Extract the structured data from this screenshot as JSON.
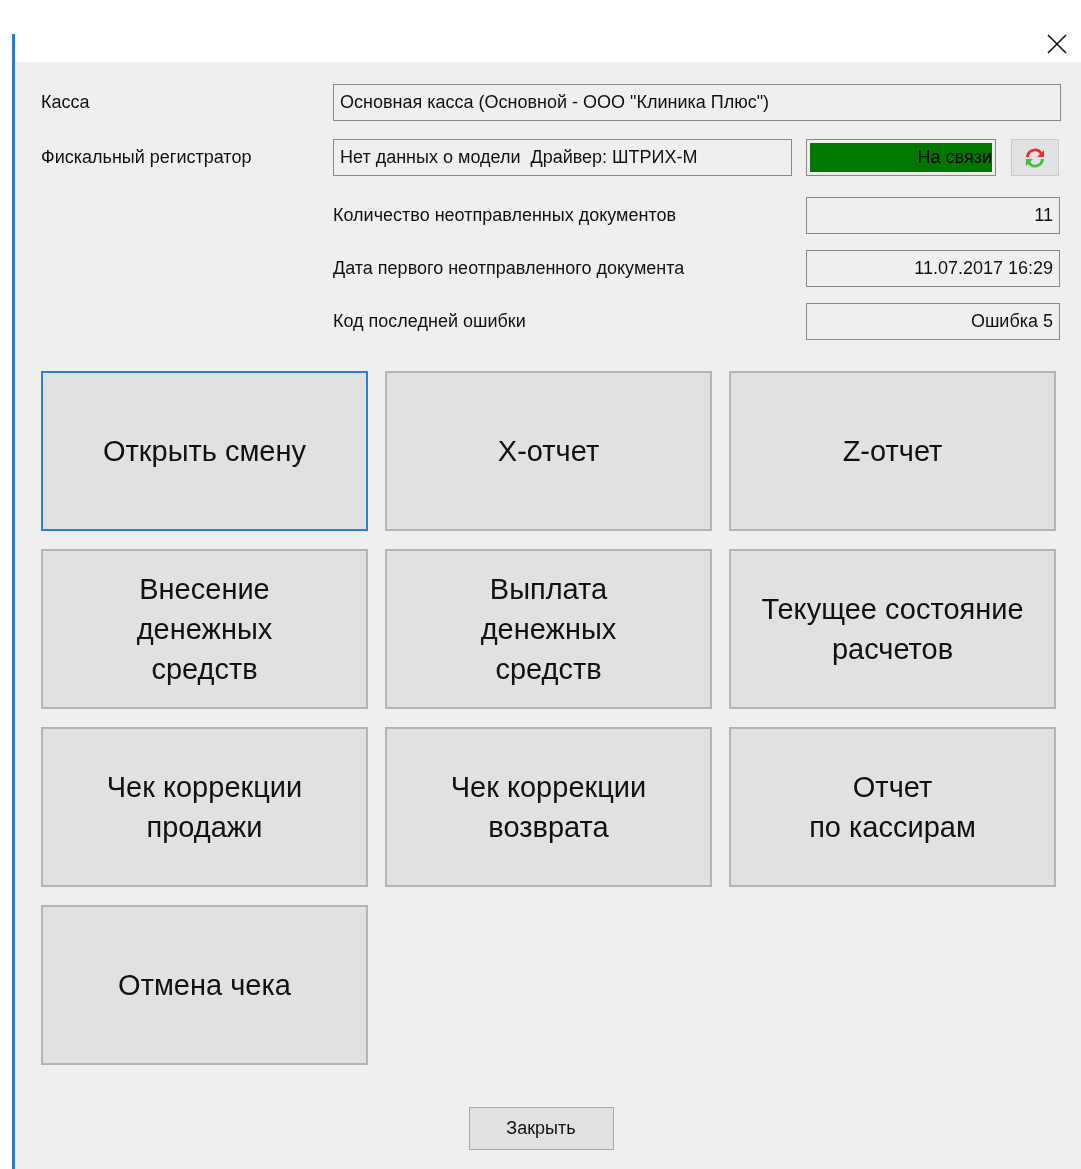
{
  "fields": [
    {
      "label": "Касса",
      "value": "Основная касса (Основной - ООО \"Клиника Плюс\")"
    },
    {
      "label": "Фискальный регистратор",
      "value": "Нет данных о модели  Драйвер: ШТРИХ-М"
    }
  ],
  "connection": {
    "text": "На связи",
    "online": true
  },
  "info": [
    {
      "label": "Количество неотправленных документов",
      "value": "11"
    },
    {
      "label": "Дата первого неотправленного документа",
      "value": "11.07.2017 16:29"
    },
    {
      "label": "Код последней ошибки",
      "value": "Ошибка 5"
    }
  ],
  "actions": [
    {
      "lines": [
        "Открыть смену"
      ],
      "focused": true
    },
    {
      "lines": [
        "X-отчет"
      ],
      "focused": false
    },
    {
      "lines": [
        "Z-отчет"
      ],
      "focused": false
    },
    {
      "lines": [
        "Внесение",
        "денежных",
        "средств"
      ],
      "focused": false
    },
    {
      "lines": [
        "Выплата",
        "денежных",
        "средств"
      ],
      "focused": false
    },
    {
      "lines": [
        "Текущее состояние",
        "расчетов"
      ],
      "focused": false
    },
    {
      "lines": [
        "Чек коррекции",
        "продажи"
      ],
      "focused": false
    },
    {
      "lines": [
        "Чек коррекции",
        "возврата"
      ],
      "focused": false
    },
    {
      "lines": [
        "Отчет",
        "по кассирам"
      ],
      "focused": false
    },
    {
      "lines": [
        "Отмена чека"
      ],
      "focused": false
    }
  ],
  "close_button": "Закрыть"
}
